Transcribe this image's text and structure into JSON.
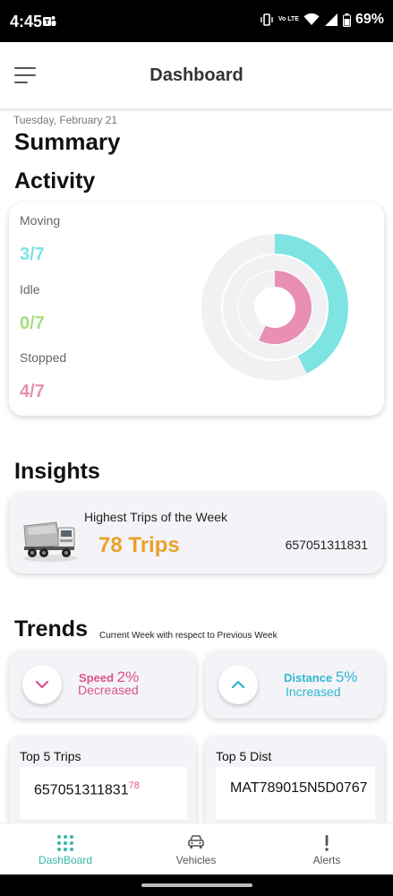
{
  "status_bar": {
    "time": "4:45",
    "network": "Vo LTE",
    "battery": "69%"
  },
  "header": {
    "title": "Dashboard",
    "menu_icon": "hamburger-icon"
  },
  "date": "Tuesday, February 21",
  "summary_title": "Summary",
  "activity": {
    "title": "Activity",
    "items": [
      {
        "label": "Moving",
        "value": "3/7",
        "color": "#7de3e3"
      },
      {
        "label": "Idle",
        "value": "0/7",
        "color": "#a8de7f"
      },
      {
        "label": "Stopped",
        "value": "4/7",
        "color": "#e88fb3"
      }
    ],
    "total": 7
  },
  "insights": {
    "title": "Insights",
    "card_title": "Highest Trips of the Week",
    "trips": "78 Trips",
    "vehicle_id": "657051311831",
    "accent_color": "#eaa12a"
  },
  "trends": {
    "title": "Trends",
    "subtitle": "Current Week with respect to Previous Week",
    "speed": {
      "label": "Speed",
      "pct": "2%",
      "status": "Decreased",
      "color": "#d9538e",
      "icon": "chevron-down-icon"
    },
    "distance": {
      "label": "Distance",
      "pct": "5%",
      "status": "Increased",
      "color": "#2fb7cf",
      "icon": "chevron-up-icon"
    }
  },
  "top_trips": {
    "title": "Top 5 Trips",
    "first_id": "657051311831",
    "first_value": "78"
  },
  "top_dist": {
    "title": "Top 5 Dist",
    "first_id": "MAT789015N5D0767"
  },
  "nav": [
    {
      "label": "DashBoard",
      "icon": "grid-icon",
      "active": true
    },
    {
      "label": "Vehicles",
      "icon": "car-icon",
      "active": false
    },
    {
      "label": "Alerts",
      "icon": "exclamation-icon",
      "active": false
    }
  ]
}
